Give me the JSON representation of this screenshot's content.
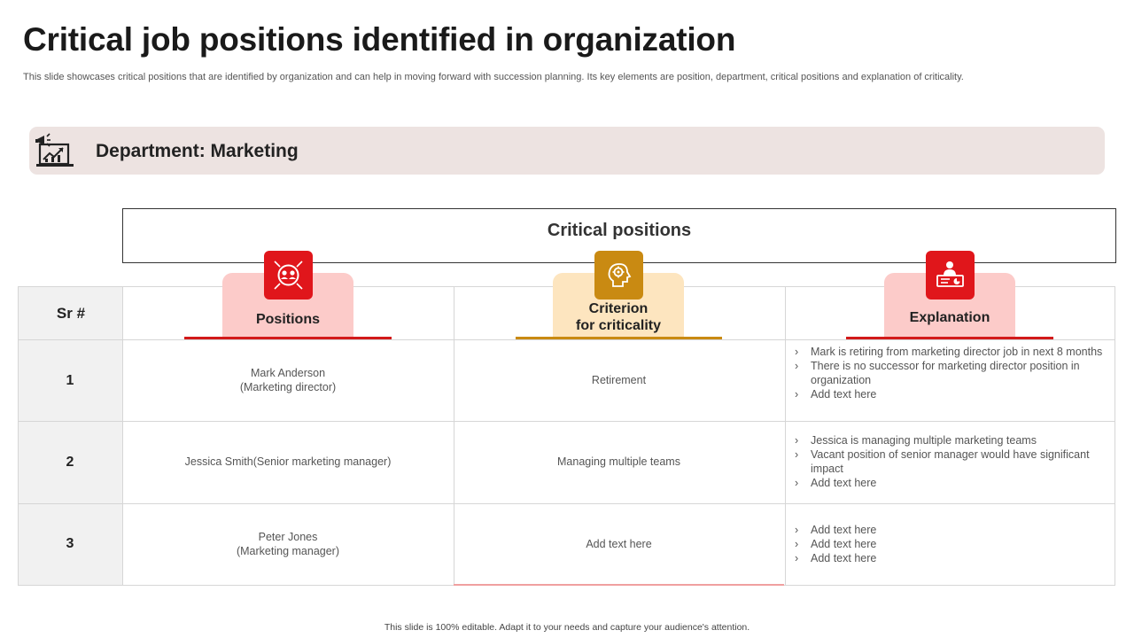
{
  "title": "Critical job positions identified in organization",
  "subtitle": "This slide showcases critical positions that are identified by organization and can help in moving forward with succession planning. Its key elements are position, department, critical positions and explanation of criticality.",
  "department": {
    "label": "Department:  Marketing",
    "icon": "marketing-chart-icon"
  },
  "critical_header": "Critical positions",
  "columns": {
    "sr": "Sr #",
    "positions": {
      "label": "Positions",
      "icon": "people-network-icon",
      "color": "#e0161b",
      "tab_color": "#fccbc9"
    },
    "criterion": {
      "line1": "Criterion",
      "line2": "for criticality",
      "icon": "head-gear-icon",
      "color": "#c98a12",
      "tab_color": "#fde5bf"
    },
    "explanation": {
      "label": "Explanation",
      "icon": "presenter-board-icon",
      "color": "#e0161b",
      "tab_color": "#fccbc9"
    }
  },
  "rows": [
    {
      "sr": "1",
      "position_line1": "Mark Anderson",
      "position_line2": "(Marketing director)",
      "criterion": "Retirement",
      "explanation": [
        "Mark is retiring from marketing director job in next 8 months",
        "There is no successor for marketing director position in organization",
        "Add text here"
      ]
    },
    {
      "sr": "2",
      "position_line1": "Jessica Smith(Senior marketing manager)",
      "position_line2": "",
      "criterion": "Managing multiple teams",
      "explanation": [
        "Jessica is managing multiple marketing teams",
        "Vacant position of senior manager would have significant impact",
        "Add text here"
      ]
    },
    {
      "sr": "3",
      "position_line1": "Peter Jones",
      "position_line2": "(Marketing manager)",
      "criterion": "Add text here",
      "explanation": [
        "Add text here",
        "Add text here",
        "Add text here"
      ]
    }
  ],
  "footer": "This slide is 100% editable.  Adapt it to your needs and capture your audience's attention."
}
